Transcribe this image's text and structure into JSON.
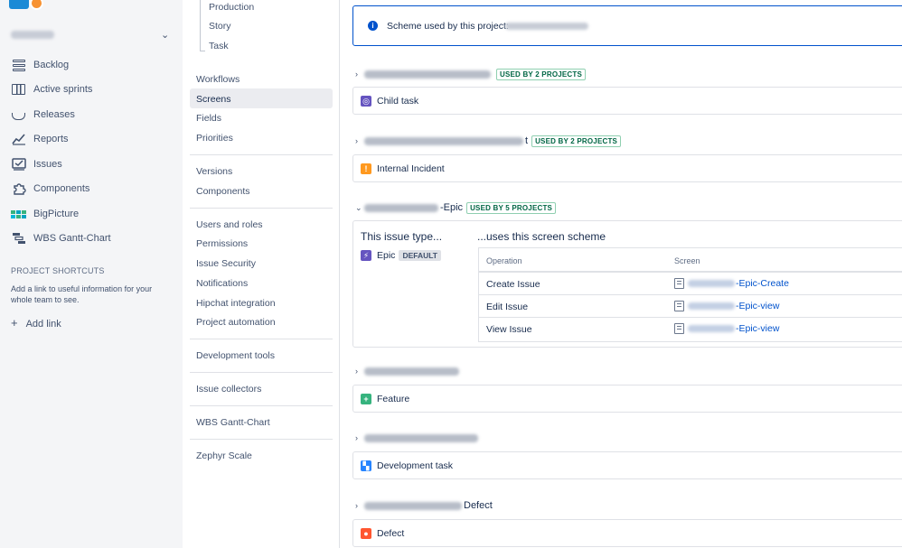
{
  "sidebar": {
    "nav": [
      {
        "label": "Backlog",
        "icon": "backlog-icon"
      },
      {
        "label": "Active sprints",
        "icon": "board-columns-icon"
      },
      {
        "label": "Releases",
        "icon": "ship-icon"
      },
      {
        "label": "Reports",
        "icon": "chart-line-icon"
      },
      {
        "label": "Issues",
        "icon": "issues-icon"
      },
      {
        "label": "Components",
        "icon": "puzzle-icon"
      },
      {
        "label": "BigPicture",
        "icon": "bigpicture-icon"
      },
      {
        "label": "WBS Gantt-Chart",
        "icon": "gantt-icon"
      }
    ],
    "shortcuts_title": "PROJECT SHORTCUTS",
    "shortcuts_text": "Add a link to useful information for your whole team to see.",
    "add_link": "Add link"
  },
  "settings_menu": {
    "issue_types": [
      "Production",
      "Story",
      "Task"
    ],
    "group1": [
      "Workflows",
      "Screens",
      "Fields",
      "Priorities"
    ],
    "group2": [
      "Versions",
      "Components"
    ],
    "group3": [
      "Users and roles",
      "Permissions",
      "Issue Security",
      "Notifications",
      "Hipchat integration",
      "Project automation"
    ],
    "group4": [
      "Development tools"
    ],
    "group5": [
      "Issue collectors"
    ],
    "group6": [
      "WBS Gantt-Chart"
    ],
    "group7": [
      "Zephyr Scale"
    ],
    "active": "Screens"
  },
  "notice": {
    "text": "Scheme used by this project:"
  },
  "schemes": [
    {
      "name_suffix": "",
      "badge": "USED BY 2 PROJECTS",
      "issue_type": "Child task",
      "icon_color": "#6554c0",
      "icon_glyph": "◎"
    },
    {
      "name_suffix": "t",
      "badge": "USED BY 2 PROJECTS",
      "issue_type": "Internal Incident",
      "icon_color": "#ff991f",
      "icon_glyph": "!"
    },
    {
      "name_suffix": "-Epic",
      "badge": "USED BY 5 PROJECTS"
    },
    {
      "name_suffix": "",
      "issue_type": "Feature",
      "icon_color": "#36b37e",
      "icon_glyph": "+"
    },
    {
      "name_suffix": "",
      "issue_type": "Development task",
      "icon_color": "#2684ff",
      "icon_glyph": "▚"
    },
    {
      "name_suffix": "Defect",
      "issue_type": "Defect",
      "icon_color": "#ff5630",
      "icon_glyph": "●"
    }
  ],
  "expanded": {
    "issue_type_header": "This issue type...",
    "uses_header": "...uses this screen scheme",
    "issue_type": "Epic",
    "issue_type_icon_color": "#6554c0",
    "default_badge": "DEFAULT",
    "col_operation": "Operation",
    "col_screen": "Screen",
    "rows": [
      {
        "operation": "Create Issue",
        "screen_suffix": "-Epic-Create"
      },
      {
        "operation": "Edit Issue",
        "screen_suffix": "-Epic-view"
      },
      {
        "operation": "View Issue",
        "screen_suffix": "-Epic-view"
      }
    ]
  }
}
